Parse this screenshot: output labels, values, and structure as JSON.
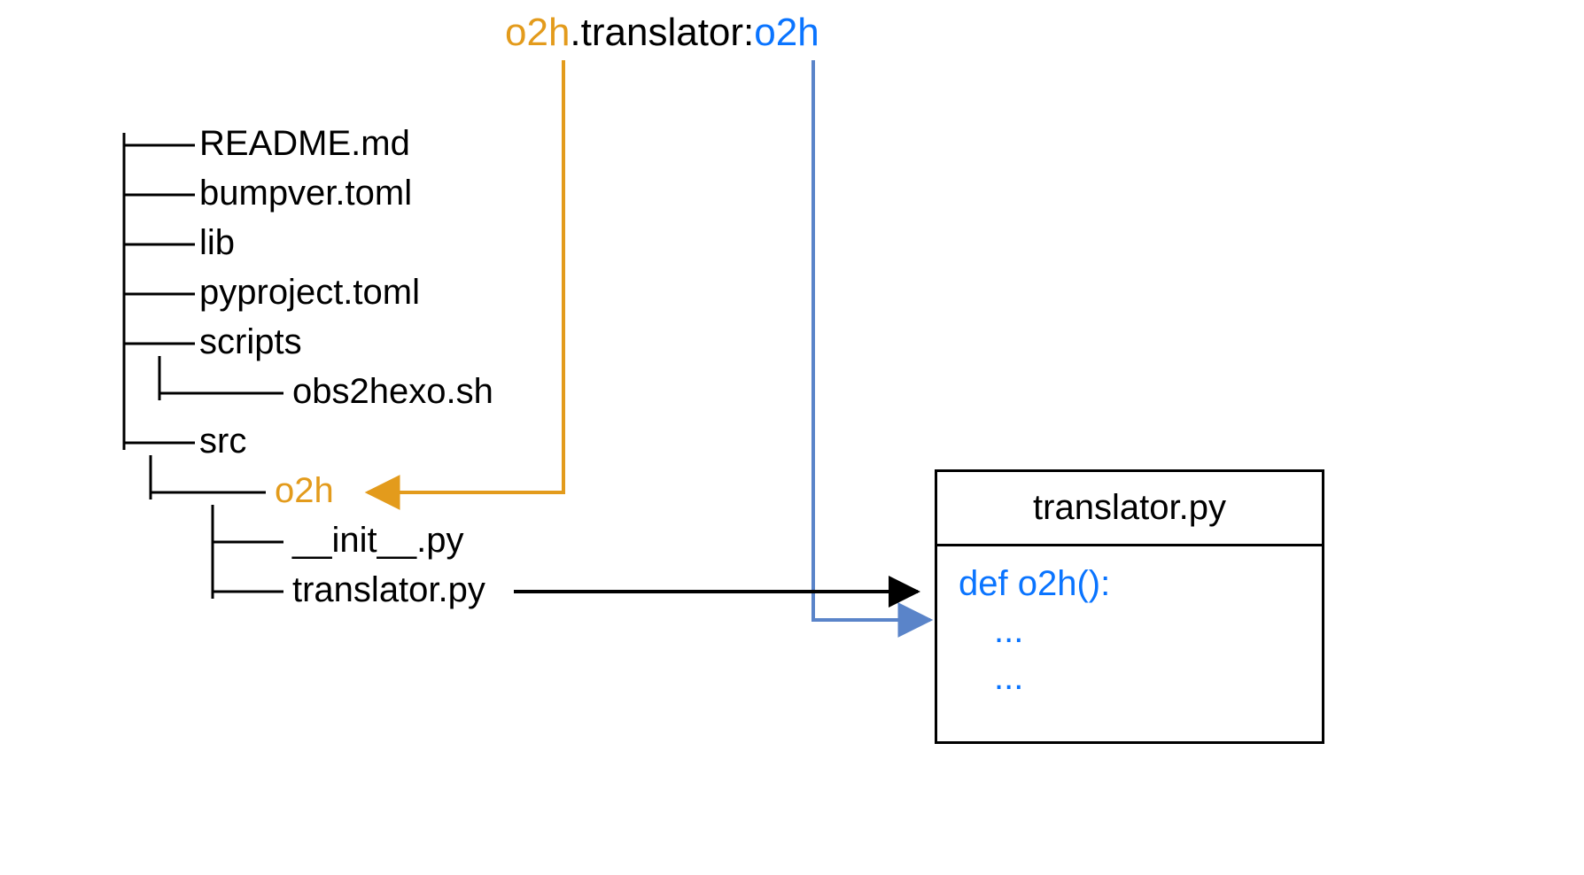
{
  "header": {
    "part1": "o2h",
    "part2": ".translator:",
    "part3": "o2h"
  },
  "tree": {
    "items": {
      "readme": "README.md",
      "bumpver": "bumpver.toml",
      "lib": "lib",
      "pyproject": "pyproject.toml",
      "scripts": "scripts",
      "obs2hexo": "obs2hexo.sh",
      "src": "src",
      "o2h": "o2h",
      "init": "__init__.py",
      "translator": "translator.py"
    }
  },
  "codebox": {
    "title": "translator.py",
    "line1": "def o2h():",
    "line2": "...",
    "line3": "..."
  },
  "colors": {
    "orange": "#e39b1c",
    "blue": "#0a74ff",
    "black": "#000000",
    "arrowBlue": "#5a84c9"
  }
}
